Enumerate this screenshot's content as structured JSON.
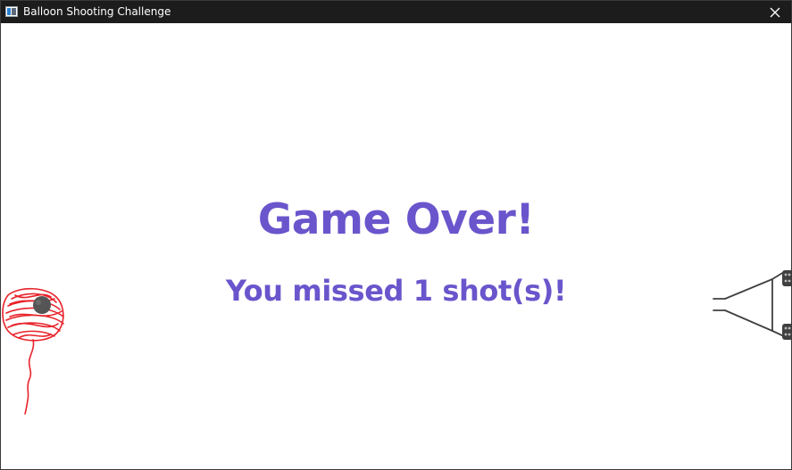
{
  "window": {
    "title": "Balloon Shooting Challenge",
    "close_glyph": "✕"
  },
  "game": {
    "headline": "Game Over!",
    "result": "You missed 1 shot(s)!",
    "missed_shots": 1
  },
  "colors": {
    "text": "#6a55cc",
    "balloon": "#e8222a",
    "bullet": "#555555",
    "cannon": "#404040",
    "titlebar": "#1c1c1c"
  },
  "icons": {
    "app": "window-app-icon",
    "close": "close-icon",
    "balloon": "balloon-icon",
    "cannon": "cannon-icon",
    "bullet": "bullet-icon"
  }
}
